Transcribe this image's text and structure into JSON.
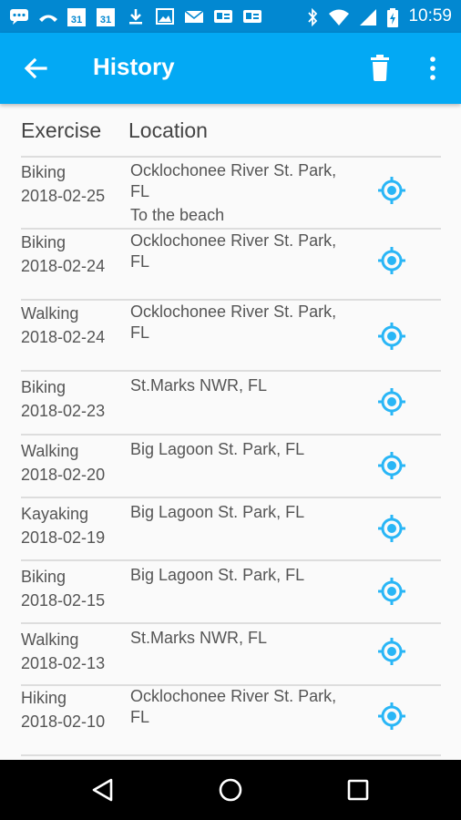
{
  "status_bar": {
    "time": "10:59",
    "icons": [
      "message-icon",
      "missed-call-icon",
      "calendar-icon",
      "calendar-icon",
      "download-icon",
      "image-icon",
      "email-icon",
      "contact-card-icon",
      "contact-card-icon",
      "bluetooth-icon",
      "wifi-icon",
      "signal-icon",
      "battery-charging-icon"
    ],
    "calendar_day": "31"
  },
  "app_bar": {
    "title": "History",
    "accent": "#03a9f4",
    "status_color": "#0288d1"
  },
  "table": {
    "headers": {
      "exercise": "Exercise",
      "location": "Location"
    },
    "rows": [
      {
        "exercise": "Biking",
        "date": "2018-02-25",
        "location": "Ocklochonee River St. Park, FL",
        "note": "To the beach"
      },
      {
        "exercise": "Biking",
        "date": "2018-02-24",
        "location": "Ocklochonee River St. Park, FL",
        "note": ""
      },
      {
        "exercise": "Walking",
        "date": "2018-02-24",
        "location": "Ocklochonee River St. Park, FL",
        "note": ""
      },
      {
        "exercise": "Biking",
        "date": "2018-02-23",
        "location": "St.Marks NWR, FL",
        "note": ""
      },
      {
        "exercise": "Walking",
        "date": "2018-02-20",
        "location": "Big Lagoon St. Park, FL",
        "note": ""
      },
      {
        "exercise": "Kayaking",
        "date": "2018-02-19",
        "location": "Big Lagoon St. Park, FL",
        "note": ""
      },
      {
        "exercise": "Biking",
        "date": "2018-02-15",
        "location": "Big Lagoon St. Park, FL",
        "note": ""
      },
      {
        "exercise": "Walking",
        "date": "2018-02-13",
        "location": "St.Marks NWR, FL",
        "note": ""
      },
      {
        "exercise": "Hiking",
        "date": "2018-02-10",
        "location": "Ocklochonee River St. Park, FL",
        "note": ""
      }
    ]
  }
}
